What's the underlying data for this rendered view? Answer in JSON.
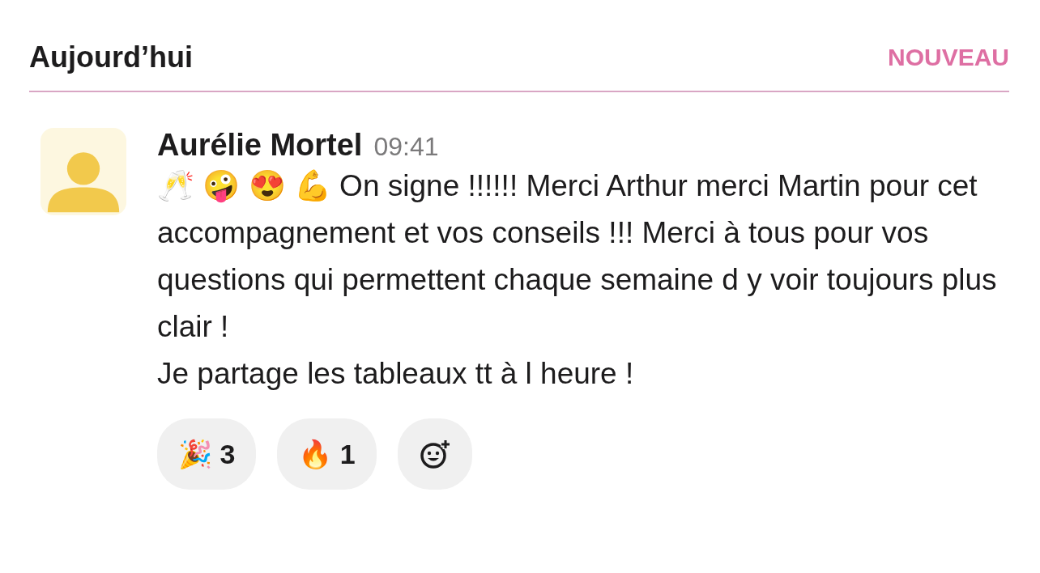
{
  "header": {
    "title": "Aujourd’hui",
    "badge": "NOUVEAU"
  },
  "message": {
    "author": "Aurélie Mortel",
    "time": "09:41",
    "paragraphs": [
      "🥂 🤪 😍 💪 On signe !!!!!! Merci Arthur merci Martin pour cet accompagnement et vos conseils !!! Merci à tous pour vos questions qui permettent chaque semaine d y voir toujours plus clair !",
      "Je partage les tableaux tt à l heure !"
    ],
    "reactions": [
      {
        "emoji": "🎉",
        "count": "3"
      },
      {
        "emoji": "🔥",
        "count": "1"
      }
    ]
  }
}
